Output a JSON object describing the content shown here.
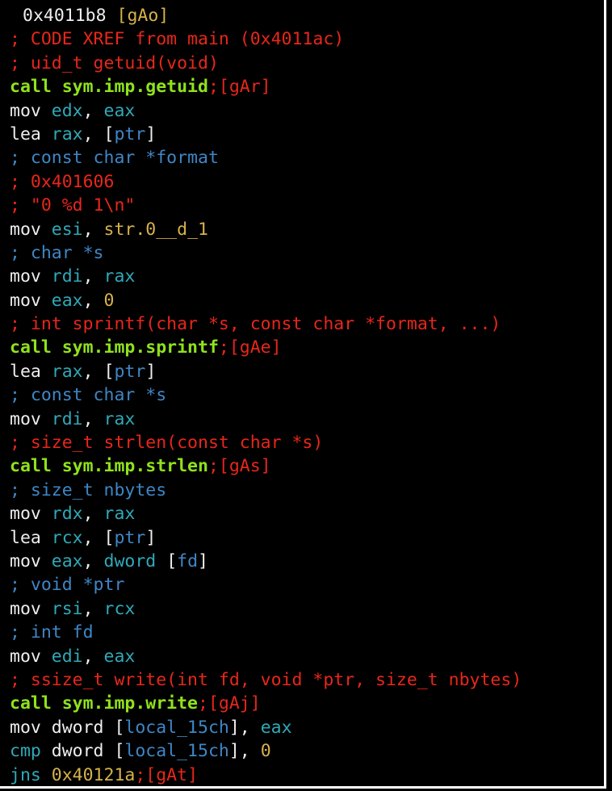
{
  "colors": {
    "background": "#000000",
    "text": "#eeeeee",
    "comment_red": "#e8261b",
    "comment_blue": "#3f86c6",
    "call_green": "#8fe21c",
    "register_cyan": "#2fa9b8",
    "yellow": "#d6b24a"
  },
  "lines": [
    [
      [
        "w",
        "0x4011b8 "
      ],
      [
        "y",
        "[gAo]"
      ]
    ],
    [
      [
        "r",
        "; CODE XREF from main (0x4011ac)"
      ]
    ],
    [
      [
        "r",
        "; uid_t getuid(void)"
      ]
    ],
    [
      [
        "g",
        "call sym.imp.getuid"
      ],
      [
        "r",
        ";[gAr]"
      ]
    ],
    [
      [
        "w",
        "mov "
      ],
      [
        "c",
        "edx"
      ],
      [
        "w",
        ", "
      ],
      [
        "c",
        "eax"
      ]
    ],
    [
      [
        "w",
        "lea "
      ],
      [
        "c",
        "rax"
      ],
      [
        "w",
        ", ["
      ],
      [
        "b",
        "ptr"
      ],
      [
        "w",
        "]"
      ]
    ],
    [
      [
        "b",
        "; const char *format"
      ]
    ],
    [
      [
        "r",
        "; 0x401606"
      ]
    ],
    [
      [
        "r",
        "; \"0 %d 1\\n\""
      ]
    ],
    [
      [
        "w",
        "mov "
      ],
      [
        "c",
        "esi"
      ],
      [
        "w",
        ", "
      ],
      [
        "y",
        "str.0__d_1"
      ]
    ],
    [
      [
        "b",
        "; char *s"
      ]
    ],
    [
      [
        "w",
        "mov "
      ],
      [
        "c",
        "rdi"
      ],
      [
        "w",
        ", "
      ],
      [
        "c",
        "rax"
      ]
    ],
    [
      [
        "w",
        "mov "
      ],
      [
        "c",
        "eax"
      ],
      [
        "w",
        ", "
      ],
      [
        "y",
        "0"
      ]
    ],
    [
      [
        "r",
        "; int sprintf(char *s, const char *format, ...)"
      ]
    ],
    [
      [
        "g",
        "call sym.imp.sprintf"
      ],
      [
        "r",
        ";[gAe]"
      ]
    ],
    [
      [
        "w",
        "lea "
      ],
      [
        "c",
        "rax"
      ],
      [
        "w",
        ", ["
      ],
      [
        "b",
        "ptr"
      ],
      [
        "w",
        "]"
      ]
    ],
    [
      [
        "b",
        "; const char *s"
      ]
    ],
    [
      [
        "w",
        "mov "
      ],
      [
        "c",
        "rdi"
      ],
      [
        "w",
        ", "
      ],
      [
        "c",
        "rax"
      ]
    ],
    [
      [
        "r",
        "; size_t strlen(const char *s)"
      ]
    ],
    [
      [
        "g",
        "call sym.imp.strlen"
      ],
      [
        "r",
        ";[gAs]"
      ]
    ],
    [
      [
        "b",
        "; size_t nbytes"
      ]
    ],
    [
      [
        "w",
        "mov "
      ],
      [
        "c",
        "rdx"
      ],
      [
        "w",
        ", "
      ],
      [
        "c",
        "rax"
      ]
    ],
    [
      [
        "w",
        "lea "
      ],
      [
        "c",
        "rcx"
      ],
      [
        "w",
        ", ["
      ],
      [
        "b",
        "ptr"
      ],
      [
        "w",
        "]"
      ]
    ],
    [
      [
        "w",
        "mov "
      ],
      [
        "c",
        "eax"
      ],
      [
        "w",
        ", "
      ],
      [
        "c",
        "dword"
      ],
      [
        "w",
        " ["
      ],
      [
        "b",
        "fd"
      ],
      [
        "w",
        "]"
      ]
    ],
    [
      [
        "b",
        "; void *ptr"
      ]
    ],
    [
      [
        "w",
        "mov "
      ],
      [
        "c",
        "rsi"
      ],
      [
        "w",
        ", "
      ],
      [
        "c",
        "rcx"
      ]
    ],
    [
      [
        "b",
        "; int fd"
      ]
    ],
    [
      [
        "w",
        "mov "
      ],
      [
        "c",
        "edi"
      ],
      [
        "w",
        ", "
      ],
      [
        "c",
        "eax"
      ]
    ],
    [
      [
        "r",
        "; ssize_t write(int fd, void *ptr, size_t nbytes)"
      ]
    ],
    [
      [
        "g",
        "call sym.imp.write"
      ],
      [
        "r",
        ";[gAj]"
      ]
    ],
    [
      [
        "w",
        "mov dword ["
      ],
      [
        "b",
        "local_15ch"
      ],
      [
        "w",
        "], "
      ],
      [
        "c",
        "eax"
      ]
    ],
    [
      [
        "c",
        "cmp "
      ],
      [
        "w",
        "dword ["
      ],
      [
        "b",
        "local_15ch"
      ],
      [
        "w",
        "], "
      ],
      [
        "y",
        "0"
      ]
    ],
    [
      [
        "c",
        "jns "
      ],
      [
        "y",
        "0x40121a"
      ],
      [
        "r",
        ";[gAt]"
      ]
    ]
  ]
}
